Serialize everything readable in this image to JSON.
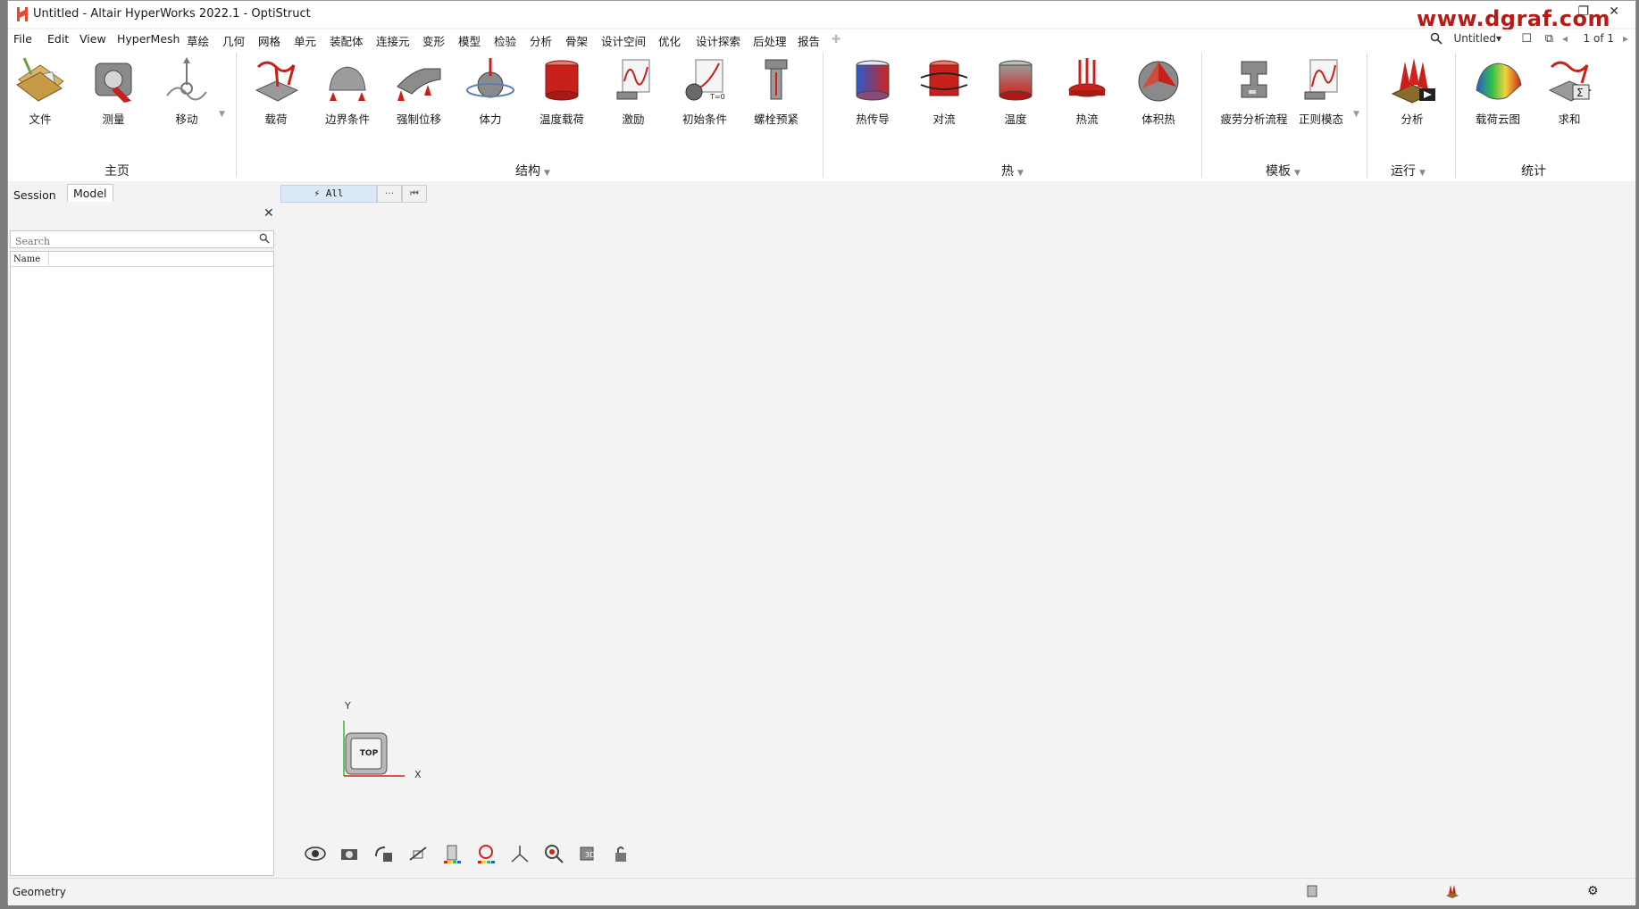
{
  "window": {
    "title": "Untitled - Altair HyperWorks 2022.1 - OptiStruct",
    "watermark": "www.dgraf.com"
  },
  "menubar": {
    "items": [
      "File",
      "Edit",
      "View",
      "HyperMesh",
      "草绘",
      "几何",
      "网格",
      "单元",
      "装配体",
      "连接元",
      "变形",
      "模型",
      "检验",
      "分析",
      "骨架",
      "设计空间",
      "优化",
      "设计探索",
      "后处理",
      "报告"
    ],
    "active": "分析",
    "session_name": "Untitled",
    "page_counter": "1 of 1"
  },
  "ribbon": {
    "groups": [
      {
        "label": "主页",
        "tools": [
          "文件",
          "测量",
          "移动"
        ]
      },
      {
        "label": "结构",
        "tools": [
          "载荷",
          "边界条件",
          "强制位移",
          "体力",
          "温度载荷",
          "激励",
          "初始条件",
          "螺栓预紧"
        ]
      },
      {
        "label": "热",
        "tools": [
          "热传导",
          "对流",
          "温度",
          "热流",
          "体积热"
        ]
      },
      {
        "label": "模板",
        "tools": [
          "疲劳分析流程",
          "正则模态"
        ]
      },
      {
        "label": "运行",
        "tools": [
          "分析"
        ]
      },
      {
        "label": "统计",
        "tools": [
          "载荷云图",
          "求和"
        ]
      }
    ]
  },
  "panel": {
    "tabs": [
      "Session",
      "Model"
    ],
    "active_tab": "Model",
    "search_placeholder": "Search",
    "column_name": "Name"
  },
  "graphics": {
    "entity_filter": "All",
    "more_label": "···",
    "axis_y": "Y",
    "axis_x": "X",
    "viewcube_face": "TOP"
  },
  "statusbar": {
    "text": "Geometry"
  },
  "colors": {
    "accent_red": "#c8211b",
    "active_underline": "#2f6fae",
    "entity_highlight": "#dbe9f6"
  }
}
